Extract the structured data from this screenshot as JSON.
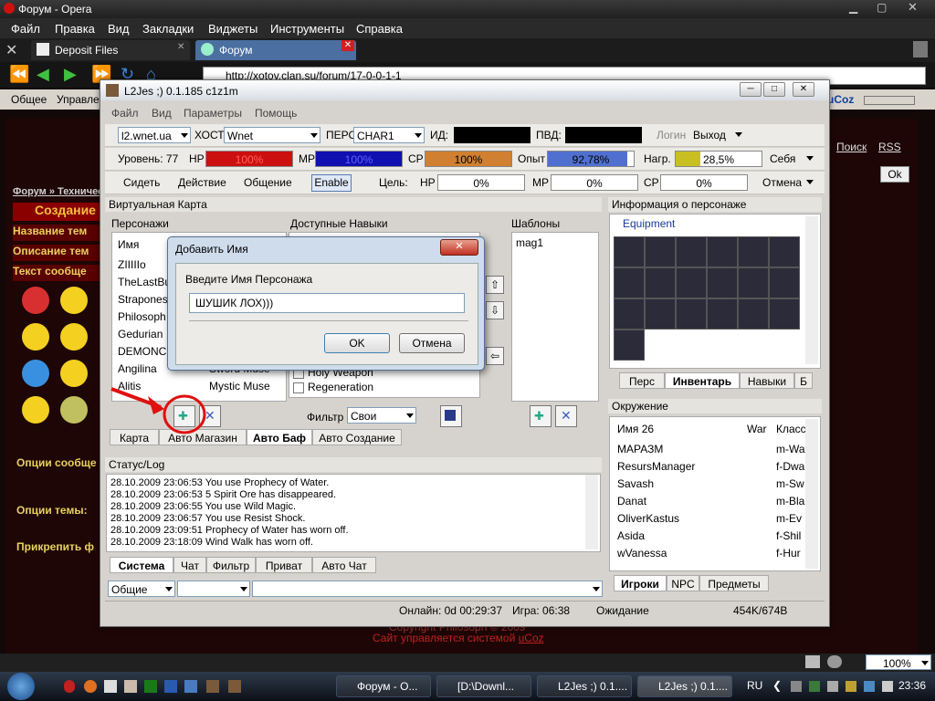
{
  "browser": {
    "title": "Форум - Opera",
    "menu": [
      "Файл",
      "Правка",
      "Вид",
      "Закладки",
      "Виджеты",
      "Инструменты",
      "Справка"
    ],
    "tabs": [
      "Deposit Files",
      "Форум"
    ],
    "address": "http://xotov.clan.su/forum/17-0-0-1-1",
    "toolbar": [
      "Общее",
      "Управлен"
    ],
    "zoom": "100%"
  },
  "webpage": {
    "breadcrumb": "Форум » Техничес",
    "heading": "Создание",
    "rows": [
      "Название тем",
      "Описание тем",
      "Текст сообще"
    ],
    "options": [
      "Опции сообще",
      "Опции темы:",
      "Прикрепить ф"
    ],
    "links": [
      "Поиск",
      "RSS"
    ],
    "ok": "Ok",
    "footer1": "Copyright Philosoph © 2009",
    "footer2": "Сайт управляется системой ",
    "footer_link": "uCoz",
    "logo": "uCoz"
  },
  "app": {
    "title": "L2Jes ;) 0.1.185 c1z1m",
    "menu": [
      "Файл",
      "Вид",
      "Параметры",
      "Помощь"
    ],
    "server": "l2.wnet.ua",
    "host_label": "ХОСТ",
    "host": "Wnet",
    "pers_label": "ПЕРС",
    "pers": "CHAR1",
    "id_label": "ИД:",
    "pvd_label": "ПВД:",
    "login": "Логин",
    "exit": "Выход",
    "level_label": "Уровень: 77",
    "hp_label": "HP",
    "hp_val": "100%",
    "mp_label": "MP",
    "mp_val": "100%",
    "cp_label": "CP",
    "cp_val": "100%",
    "exp_label": "Опыт",
    "exp_val": "92,78%",
    "load_label": "Нагр.",
    "load_val": "28,5%",
    "self": "Себя",
    "sit": "Сидеть",
    "action": "Действие",
    "social": "Общение",
    "enable": "Enable",
    "target_label": "Цель:",
    "t_hp": "HP",
    "t_hp_val": "0%",
    "t_mp": "MP",
    "t_mp_val": "0%",
    "t_cp": "CP",
    "t_cp_val": "0%",
    "cancel": "Отмена",
    "vmap_title": "Виртуальная Карта",
    "chars_label": "Персонажи",
    "skills_label": "Доступные Навыки",
    "templates_label": "Шаблоны",
    "name_col": "Имя",
    "characters": [
      "ZIIIIIo",
      "TheLastBu",
      "Straponess",
      "Philosoph",
      "Gedurian",
      "DEMONCR",
      "Angilina",
      "Alitis"
    ],
    "skills": [
      "Sword Muse",
      "Mystic Muse",
      "Holy Weapon",
      "Regeneration"
    ],
    "template_items": [
      "mag1"
    ],
    "filter_label": "Фильтр",
    "filter": "Свои",
    "bottom_tabs": [
      "Карта",
      "Авто Магазин",
      "Авто Баф",
      "Авто Создание"
    ],
    "status_title": "Статус/Log",
    "log": [
      "28.10.2009 23:06:53 You use Prophecy of Water.",
      "28.10.2009 23:06:53 5 Spirit Ore has disappeared.",
      "28.10.2009 23:06:55 You use Wild Magic.",
      "28.10.2009 23:06:57 You use Resist Shock.",
      "28.10.2009 23:09:51 Prophecy of Water has worn off.",
      "28.10.2009 23:18:09 Wind Walk has worn off."
    ],
    "log_tabs": [
      "Система",
      "Чат",
      "Фильтр",
      "Приват",
      "Авто Чат"
    ],
    "chat_channel": "Общие",
    "online": "Онлайн: 0d 00:29:37",
    "game": "Игра: 06:38",
    "waiting": "Ожидание",
    "memory": "454K/674B",
    "info_title": "Информация о персонаже",
    "equipment": "Equipment",
    "info_tabs": [
      "Перс",
      "Инвентарь",
      "Навыки",
      "Б"
    ],
    "env_title": "Окружение",
    "env_cols": [
      "Имя 26",
      "War",
      "Класс"
    ],
    "env_rows": [
      {
        "name": "МАРАЗМ",
        "cls": "m-Wa"
      },
      {
        "name": "ResursManager",
        "cls": "f-Dwa"
      },
      {
        "name": "Savash",
        "cls": "m-Sw"
      },
      {
        "name": "Danat",
        "cls": "m-Bla"
      },
      {
        "name": "OliverKastus",
        "cls": "m-Ev"
      },
      {
        "name": "Asida",
        "cls": "f-Shil"
      },
      {
        "name": "wVanessa",
        "cls": "f-Hur"
      }
    ],
    "env_tabs": [
      "Игроки",
      "NPC",
      "Предметы"
    ]
  },
  "dialog": {
    "title": "Добавить Имя",
    "prompt": "Введите Имя Персонажа",
    "value": "ШУШИК ЛОХ)))",
    "ok": "OK",
    "cancel": "Отмена"
  },
  "taskbar": {
    "items": [
      "Форум - O...",
      "[D:\\Downl...",
      "L2Jes ;) 0.1....",
      "L2Jes ;) 0.1...."
    ],
    "lang": "RU",
    "time": "23:36"
  },
  "colors": {
    "hp": "#cc1010",
    "mp": "#1010b0",
    "cp": "#d08030",
    "exp": "#5070d0",
    "load": "#c8c020",
    "annotation": "#e01010"
  }
}
